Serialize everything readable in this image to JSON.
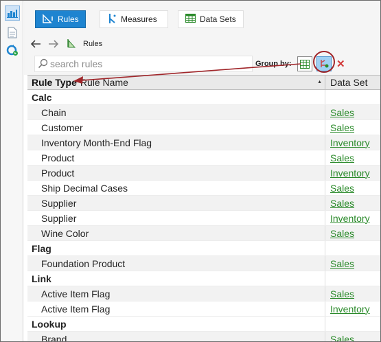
{
  "toolbar": {
    "rules_label": "Rules",
    "measures_label": "Measures",
    "datasets_label": "Data Sets"
  },
  "nav": {
    "breadcrumb": "Rules"
  },
  "filter": {
    "search_placeholder": "search rules",
    "groupby_label": "Group by:"
  },
  "table": {
    "header_group": "Rule Type",
    "header_name": "Rule Name",
    "header_dataset": "Data Set",
    "rows": [
      {
        "kind": "group",
        "name": "Calc",
        "dataset": ""
      },
      {
        "kind": "item",
        "name": "Chain",
        "dataset": "Sales"
      },
      {
        "kind": "item",
        "name": "Customer",
        "dataset": "Sales"
      },
      {
        "kind": "item",
        "name": "Inventory Month-End Flag",
        "dataset": "Inventory"
      },
      {
        "kind": "item",
        "name": "Product",
        "dataset": "Sales"
      },
      {
        "kind": "item",
        "name": "Product",
        "dataset": "Inventory"
      },
      {
        "kind": "item",
        "name": "Ship Decimal Cases",
        "dataset": "Sales"
      },
      {
        "kind": "item",
        "name": "Supplier",
        "dataset": "Sales"
      },
      {
        "kind": "item",
        "name": "Supplier",
        "dataset": "Inventory"
      },
      {
        "kind": "item",
        "name": "Wine Color",
        "dataset": "Sales"
      },
      {
        "kind": "group",
        "name": "Flag",
        "dataset": ""
      },
      {
        "kind": "item",
        "name": "Foundation Product",
        "dataset": "Sales"
      },
      {
        "kind": "group",
        "name": "Link",
        "dataset": ""
      },
      {
        "kind": "item",
        "name": "Active Item Flag",
        "dataset": "Sales"
      },
      {
        "kind": "item",
        "name": "Active Item Flag",
        "dataset": "Inventory"
      },
      {
        "kind": "group",
        "name": "Lookup",
        "dataset": ""
      },
      {
        "kind": "item",
        "name": "Brand",
        "dataset": "Sales"
      }
    ]
  },
  "colors": {
    "accent": "#1e84d0",
    "link": "#2a8a2a",
    "annotation": "#a0262a"
  },
  "icons": {
    "rail": [
      "dashboard-icon",
      "document-icon",
      "refresh-icon"
    ],
    "groupby": [
      "group-by-grid-icon",
      "group-by-type-icon"
    ]
  }
}
